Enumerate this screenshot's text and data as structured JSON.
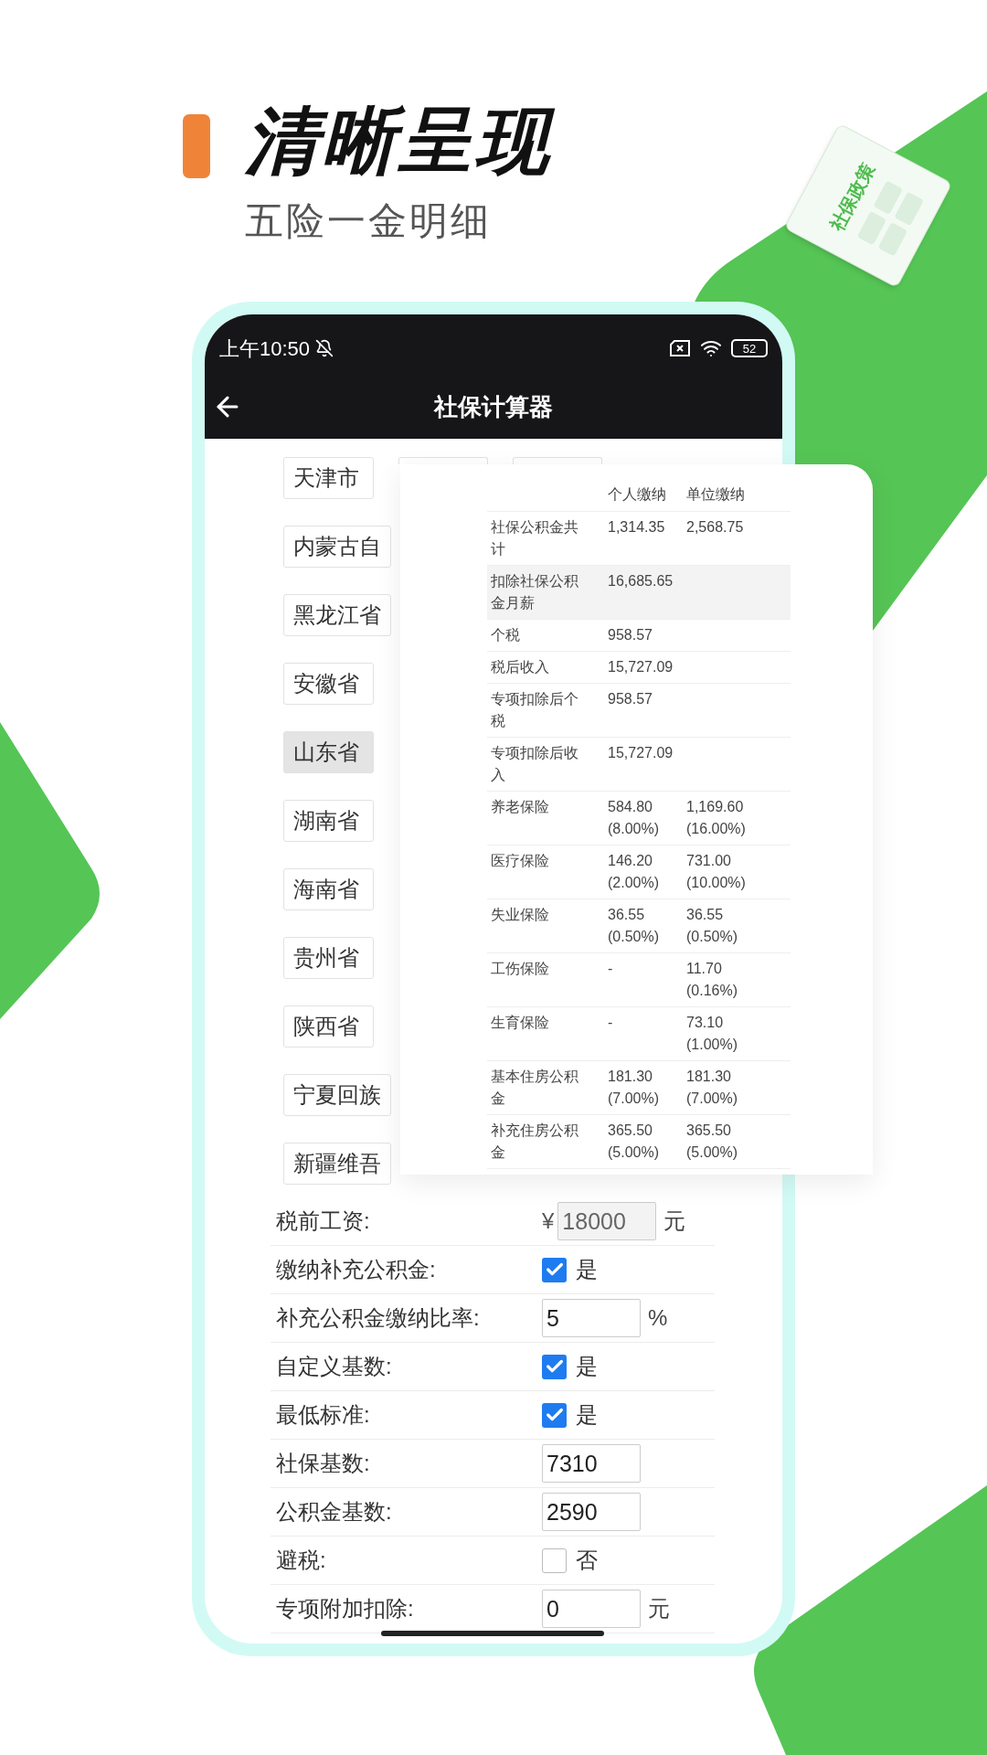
{
  "headline": {
    "title": "清晰呈现",
    "subtitle": "五险一金明细"
  },
  "document_badge": {
    "label": "社保政策"
  },
  "status_bar": {
    "time": "上午10:50",
    "battery": "52"
  },
  "app_bar": {
    "title": "社保计算器"
  },
  "province_rows": [
    [
      {
        "kind": "city",
        "label": "天津市",
        "selected": false
      },
      {
        "kind": "empty"
      },
      {
        "kind": "empty"
      }
    ],
    [
      {
        "kind": "city",
        "label": "内蒙古自",
        "selected": false
      }
    ],
    [
      {
        "kind": "city",
        "label": "黑龙江省",
        "selected": false
      }
    ],
    [
      {
        "kind": "city",
        "label": "安徽省",
        "selected": false
      }
    ],
    [
      {
        "kind": "city",
        "label": "山东省",
        "selected": true
      }
    ],
    [
      {
        "kind": "city",
        "label": "湖南省",
        "selected": false
      }
    ],
    [
      {
        "kind": "city",
        "label": "海南省",
        "selected": false
      }
    ],
    [
      {
        "kind": "city",
        "label": "贵州省",
        "selected": false
      }
    ],
    [
      {
        "kind": "city",
        "label": "陕西省",
        "selected": false
      }
    ],
    [
      {
        "kind": "city",
        "label": "宁夏回族",
        "selected": false
      }
    ],
    [
      {
        "kind": "city",
        "label": "新疆维吾",
        "selected": false
      }
    ]
  ],
  "results_table": {
    "columns": [
      "个人缴纳",
      "单位缴纳"
    ],
    "rows": [
      {
        "label": "社保公积金共计",
        "personal": "1,314.35",
        "company": "2,568.75",
        "highlighted": false
      },
      {
        "label": "扣除社保公积金月薪",
        "personal": "16,685.65",
        "highlighted": true
      },
      {
        "label": "个税",
        "personal": "958.57",
        "highlighted": false
      },
      {
        "label": "税后收入",
        "personal": "15,727.09",
        "highlighted": false
      },
      {
        "label": "专项扣除后个税",
        "personal": "958.57",
        "highlighted": false
      },
      {
        "label": "专项扣除后收入",
        "personal": "15,727.09",
        "highlighted": false
      },
      {
        "label": "养老保险",
        "personal": "584.80 (8.00%)",
        "company": "1,169.60 (16.00%)",
        "highlighted": false
      },
      {
        "label": "医疗保险",
        "personal": "146.20 (2.00%)",
        "company": "731.00 (10.00%)",
        "highlighted": false
      },
      {
        "label": "失业保险",
        "personal": "36.55 (0.50%)",
        "company": "36.55 (0.50%)",
        "highlighted": false
      },
      {
        "label": "工伤保险",
        "personal": "-",
        "company": "11.70 (0.16%)",
        "highlighted": false
      },
      {
        "label": "生育保险",
        "personal": "-",
        "company": "73.10 (1.00%)",
        "highlighted": false
      },
      {
        "label": "基本住房公积金",
        "personal": "181.30 (7.00%)",
        "company": "181.30 (7.00%)",
        "highlighted": false
      },
      {
        "label": "补充住房公积金",
        "personal": "365.50 (5.00%)",
        "company": "365.50 (5.00%)",
        "highlighted": false
      }
    ]
  },
  "form_rows": [
    {
      "kind": "input",
      "label": "税前工资:",
      "prefix": "¥",
      "value": "18000",
      "unit": "元",
      "disabled": true
    },
    {
      "kind": "checkbox",
      "label": "缴纳补充公积金:",
      "checked": true,
      "text": "是"
    },
    {
      "kind": "input",
      "label": "补充公积金缴纳比率:",
      "value": "5",
      "unit": "%",
      "disabled": false
    },
    {
      "kind": "checkbox",
      "label": "自定义基数:",
      "checked": true,
      "text": "是"
    },
    {
      "kind": "checkbox",
      "label": "最低标准:",
      "checked": true,
      "text": "是"
    },
    {
      "kind": "input",
      "label": "社保基数:",
      "value": "7310",
      "disabled": false
    },
    {
      "kind": "input",
      "label": "公积金基数:",
      "value": "2590",
      "disabled": false
    },
    {
      "kind": "checkbox",
      "label": "避税:",
      "checked": false,
      "text": "否"
    },
    {
      "kind": "input",
      "label": "专项附加扣除:",
      "value": "0",
      "unit": "元",
      "disabled": false
    }
  ]
}
